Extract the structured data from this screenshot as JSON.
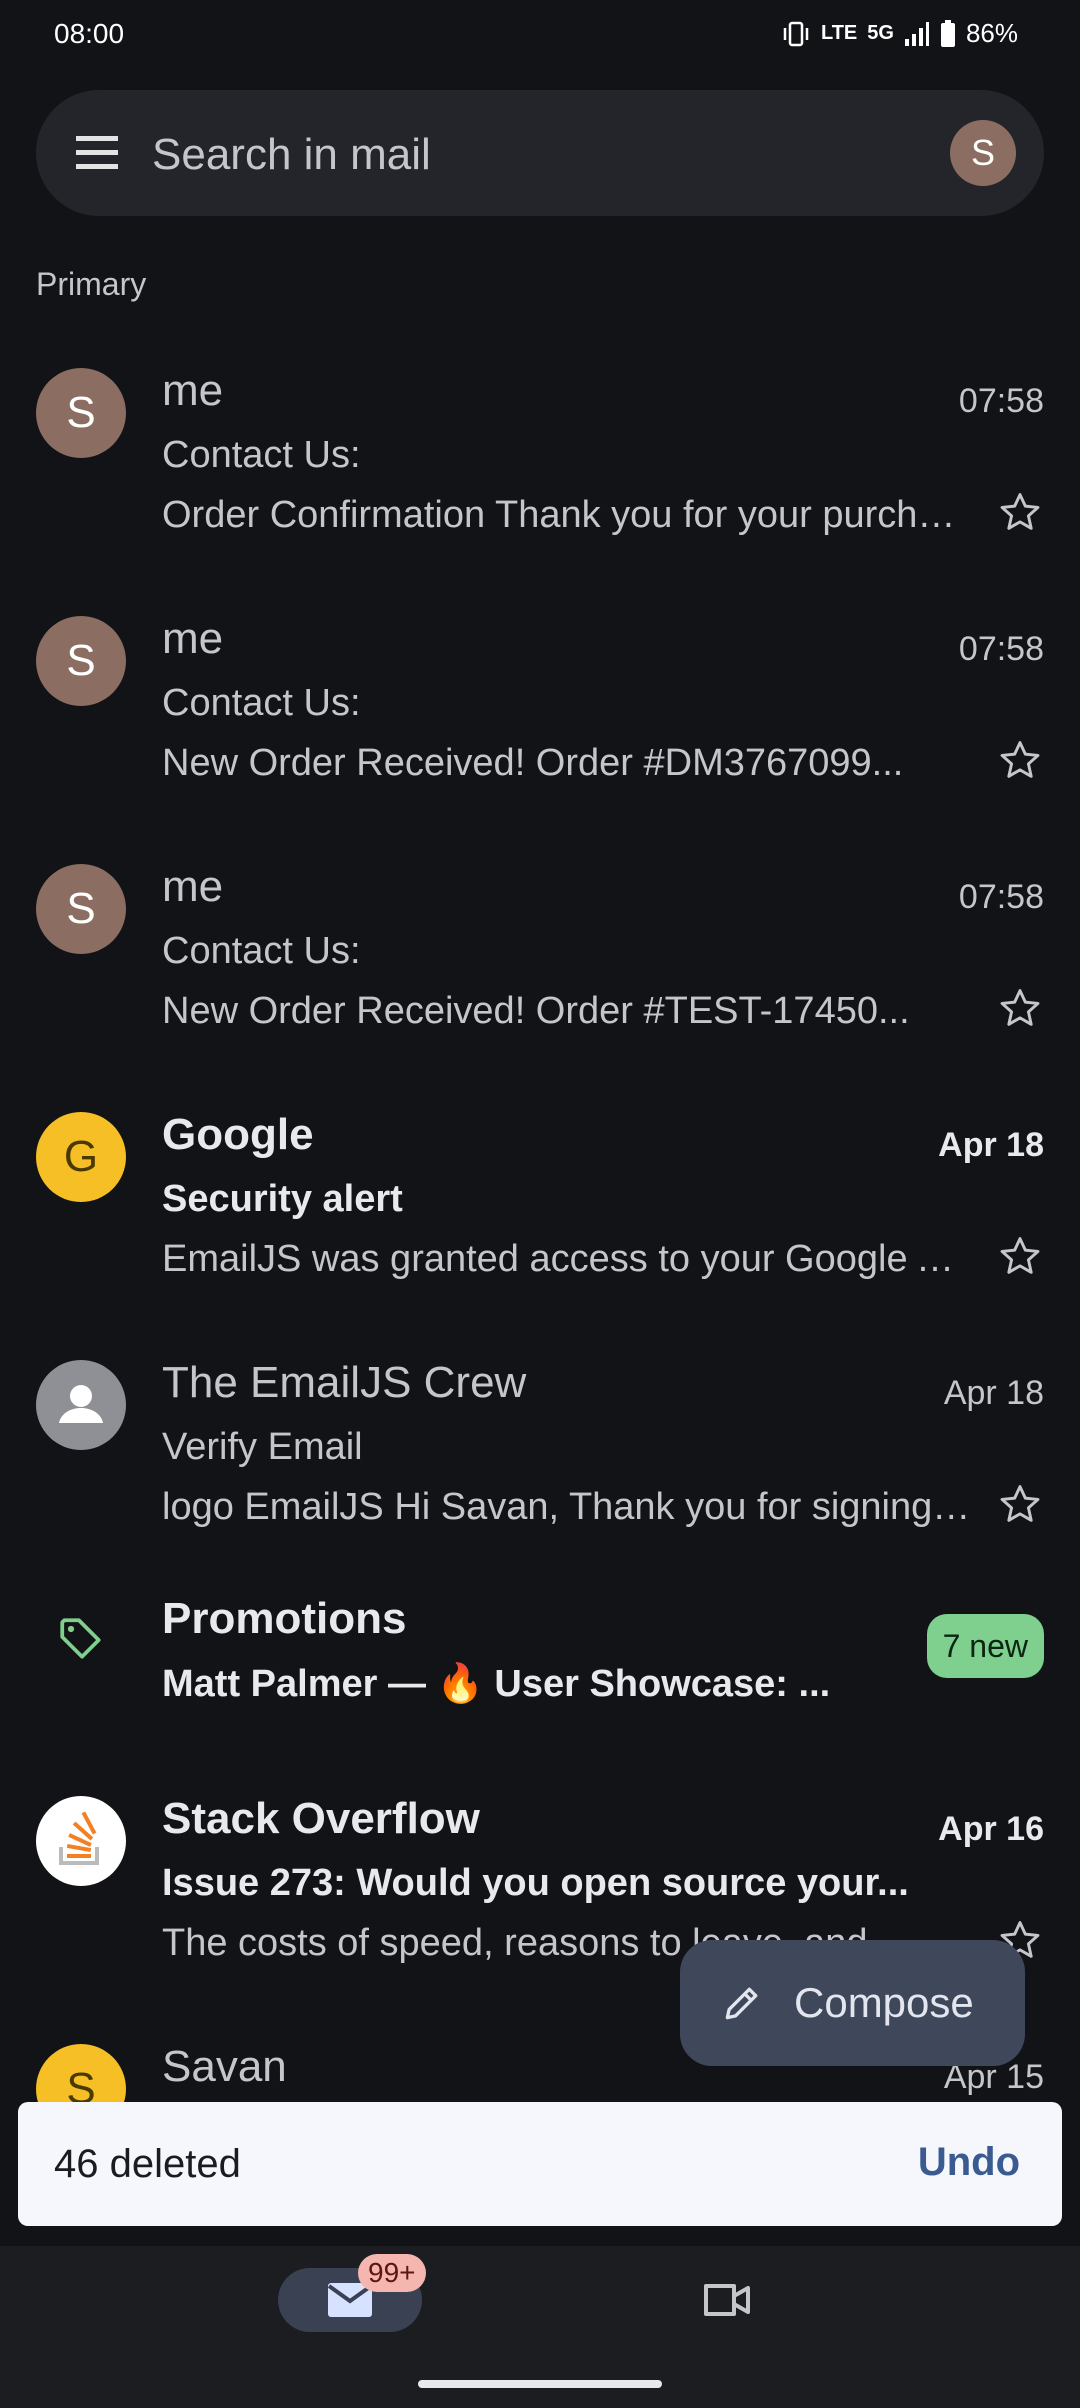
{
  "status_bar": {
    "time": "08:00",
    "network": "5G",
    "battery": "86%"
  },
  "search": {
    "placeholder": "Search in mail",
    "avatar_letter": "S"
  },
  "section_label": "Primary",
  "emails": [
    {
      "avatar": "S",
      "sender": "me",
      "date": "07:58",
      "subject": "Contact Us:",
      "snippet": "Order Confirmation Thank you for your purchase!",
      "unread": false
    },
    {
      "avatar": "S",
      "sender": "me",
      "date": "07:58",
      "subject": "Contact Us:",
      "snippet": "New Order Received! Order #DM3767099...",
      "unread": false
    },
    {
      "avatar": "S",
      "sender": "me",
      "date": "07:58",
      "subject": "Contact Us:",
      "snippet": "New Order Received! Order #TEST-17450...",
      "unread": false
    },
    {
      "avatar": "G",
      "sender": "Google",
      "date": "Apr 18",
      "subject": "Security alert",
      "snippet": "EmailJS was granted access to your Google Account",
      "unread": true
    },
    {
      "avatar": "",
      "sender": "The EmailJS Crew",
      "date": "Apr 18",
      "subject": "Verify Email",
      "snippet": "logo EmailJS Hi Savan, Thank you for signing up",
      "unread": false
    }
  ],
  "promotions": {
    "title": "Promotions",
    "subtitle": "Matt Palmer — 🔥 User Showcase: ...",
    "badge": "7 new"
  },
  "stack_overflow": {
    "sender": "Stack Overflow",
    "date": "Apr 16",
    "subject": "Issue 273: Would you open source your...",
    "snippet": "The costs of speed, reasons to leave, and..."
  },
  "savan": {
    "avatar": "S",
    "sender": "Savan",
    "date": "Apr 15"
  },
  "compose": {
    "label": "Compose"
  },
  "snackbar": {
    "text": "46 deleted",
    "action": "Undo"
  },
  "bottom_nav": {
    "mail_badge": "99+"
  },
  "colors": {
    "background": "#121316",
    "accent_green": "#7fcf8e",
    "avatar_brown": "#8c6d62",
    "google_yellow": "#f6bf26",
    "stack_orange": "#f48024"
  },
  "icons": [
    "menu-icon",
    "star-icon",
    "tag-icon",
    "pencil-icon",
    "mail-icon",
    "video-icon",
    "person-icon",
    "stack-overflow-icon"
  ]
}
